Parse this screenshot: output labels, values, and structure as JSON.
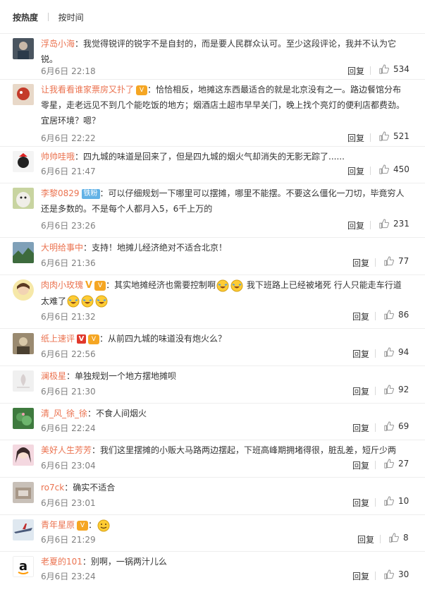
{
  "sort": {
    "hot_label": "按热度",
    "time_label": "按时间"
  },
  "reply_label": "回复",
  "comments": [
    {
      "user": "浮岛小海",
      "lines": [
        "：我觉得锐评的锐字不是自封的，而是要人民群众认可。至少这段评论，我并不认为它",
        "锐。"
      ],
      "time": "6月6日 22:18",
      "likes": "534"
    },
    {
      "user": "让我看看谁家票房又扑了",
      "badge": "vip",
      "lines": [
        "：恰恰相反，地摊这东西最适合的就是北京没有之一。路边餐馆分布",
        "零星，走老远见不到几个能吃饭的地方；烟酒店土超市早早关门，晚上找个亮灯的便利店都费劲。",
        "宜居环境？嗯？"
      ],
      "time": "6月6日 22:22",
      "likes": "521"
    },
    {
      "user": "帅帅哇哦",
      "lines": [
        "：四九城的味道是回来了，但是四九城的烟火气却消失的无影无踪了......"
      ],
      "time": "6月6日 21:47",
      "likes": "450"
    },
    {
      "user": "李黎0829",
      "badge": "fan",
      "badge_text": "铁粉",
      "lines": [
        "：可以仔细规划一下哪里可以摆摊，哪里不能摆。不要这么僵化一刀切，毕竟穷人",
        "还是多数的。不是每个人都月入5，6千上万的"
      ],
      "time": "6月6日 23:26",
      "likes": "231"
    },
    {
      "user": "大明给事中",
      "lines": [
        "：支持！地摊儿经济绝对不适合北京！"
      ],
      "time": "6月6日 21:36",
      "likes": "77"
    },
    {
      "user": "肉肉小玫瑰",
      "badge": "v-vip",
      "lines": [
        "：其实地摊经济也需要控制啊",
        "太难了"
      ],
      "emoji_line1": "laugh-cry-emoji",
      "text_after_emoji": " 我下班路上已经被堵死 行人只能走车行道",
      "time": "6月6日 21:32",
      "likes": "86"
    },
    {
      "user": "纸上速评",
      "badge": "vred-vip",
      "lines": [
        "：从前四九城的味道没有炮火么？"
      ],
      "time": "6月6日 22:56",
      "likes": "94"
    },
    {
      "user": "澜极星",
      "lines": [
        "：单独规划一个地方摆地摊呗"
      ],
      "time": "6月6日 21:30",
      "likes": "92"
    },
    {
      "user": "清_风_徐_徐",
      "lines": [
        "：不食人间烟火"
      ],
      "time": "6月6日 22:24",
      "likes": "69"
    },
    {
      "user": "美好人生芳芳",
      "lines": [
        "：我们这里摆摊的小贩大马路两边摆起，下班高峰期拥堵得很，脏乱差，短斤少两"
      ],
      "time": "6月6日 23:04",
      "likes": "27"
    },
    {
      "user": "ro7ck",
      "lines": [
        "：确实不适合"
      ],
      "time": "6月6日 23:01",
      "likes": "10"
    },
    {
      "user": "青年星原",
      "badge": "vip",
      "lines": [
        "："
      ],
      "emoji_only": "smile-emoji",
      "time": "6月6日 21:29",
      "likes": "8"
    },
    {
      "user": "老夏的101",
      "lines": [
        "：别啊，一锅两汁儿么"
      ],
      "time": "6月6日 23:24",
      "likes": "30"
    }
  ],
  "colors": {
    "name": "#eb7350",
    "meta": "#808080",
    "divider": "#eeeeee"
  }
}
